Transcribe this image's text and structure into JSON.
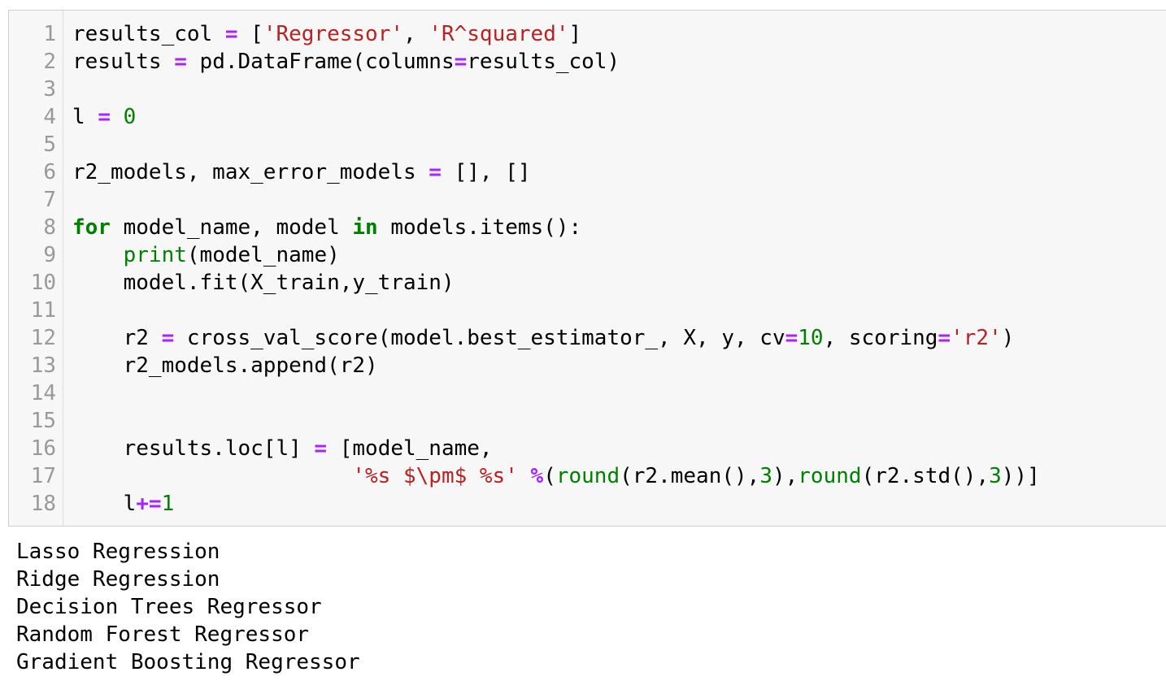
{
  "editor": {
    "line_numbers": [
      "1",
      "2",
      "3",
      "4",
      "5",
      "6",
      "7",
      "8",
      "9",
      "10",
      "11",
      "12",
      "13",
      "14",
      "15",
      "16",
      "17",
      "18"
    ],
    "lines": [
      [
        {
          "t": "plain",
          "v": "results_col "
        },
        {
          "t": "op",
          "v": "="
        },
        {
          "t": "plain",
          "v": " ["
        },
        {
          "t": "str",
          "v": "'Regressor'"
        },
        {
          "t": "plain",
          "v": ", "
        },
        {
          "t": "str",
          "v": "'R^squared'"
        },
        {
          "t": "plain",
          "v": "]"
        }
      ],
      [
        {
          "t": "plain",
          "v": "results "
        },
        {
          "t": "op",
          "v": "="
        },
        {
          "t": "plain",
          "v": " pd.DataFrame(columns"
        },
        {
          "t": "op",
          "v": "="
        },
        {
          "t": "plain",
          "v": "results_col)"
        }
      ],
      [],
      [
        {
          "t": "plain",
          "v": "l "
        },
        {
          "t": "op",
          "v": "="
        },
        {
          "t": "plain",
          "v": " "
        },
        {
          "t": "num",
          "v": "0"
        }
      ],
      [],
      [
        {
          "t": "plain",
          "v": "r2_models, max_error_models "
        },
        {
          "t": "op",
          "v": "="
        },
        {
          "t": "plain",
          "v": " [], []"
        }
      ],
      [],
      [
        {
          "t": "kw",
          "v": "for"
        },
        {
          "t": "plain",
          "v": " model_name, model "
        },
        {
          "t": "kw",
          "v": "in"
        },
        {
          "t": "plain",
          "v": " models.items():"
        }
      ],
      [
        {
          "t": "plain",
          "v": "    "
        },
        {
          "t": "builtin",
          "v": "print"
        },
        {
          "t": "plain",
          "v": "(model_name)"
        }
      ],
      [
        {
          "t": "plain",
          "v": "    model.fit(X_train,y_train)"
        }
      ],
      [],
      [
        {
          "t": "plain",
          "v": "    r2 "
        },
        {
          "t": "op",
          "v": "="
        },
        {
          "t": "plain",
          "v": " cross_val_score(model.best_estimator_, X, y, cv"
        },
        {
          "t": "op",
          "v": "="
        },
        {
          "t": "num",
          "v": "10"
        },
        {
          "t": "plain",
          "v": ", scoring"
        },
        {
          "t": "op",
          "v": "="
        },
        {
          "t": "str",
          "v": "'r2'"
        },
        {
          "t": "plain",
          "v": ")"
        }
      ],
      [
        {
          "t": "plain",
          "v": "    r2_models.append(r2)"
        }
      ],
      [],
      [],
      [
        {
          "t": "plain",
          "v": "    results.loc[l] "
        },
        {
          "t": "op",
          "v": "="
        },
        {
          "t": "plain",
          "v": " [model_name,"
        }
      ],
      [
        {
          "t": "plain",
          "v": "                      "
        },
        {
          "t": "str",
          "v": "'%s $\\pm$ %s'"
        },
        {
          "t": "plain",
          "v": " "
        },
        {
          "t": "op",
          "v": "%"
        },
        {
          "t": "plain",
          "v": "("
        },
        {
          "t": "builtin",
          "v": "round"
        },
        {
          "t": "plain",
          "v": "(r2.mean(),"
        },
        {
          "t": "num",
          "v": "3"
        },
        {
          "t": "plain",
          "v": "),"
        },
        {
          "t": "builtin",
          "v": "round"
        },
        {
          "t": "plain",
          "v": "(r2.std(),"
        },
        {
          "t": "num",
          "v": "3"
        },
        {
          "t": "plain",
          "v": "))]"
        }
      ],
      [
        {
          "t": "plain",
          "v": "    l"
        },
        {
          "t": "op",
          "v": "+="
        },
        {
          "t": "num",
          "v": "1"
        }
      ]
    ]
  },
  "output": {
    "lines": [
      "Lasso Regression",
      "Ridge Regression",
      "Decision Trees Regressor",
      "Random Forest Regressor",
      "Gradient Boosting Regressor"
    ]
  },
  "colors": {
    "keyword": "#008000",
    "operator": "#aa22ff",
    "string": "#ba2121",
    "number": "#008000",
    "cell_background": "#f7f7f7",
    "line_number": "#999999"
  }
}
